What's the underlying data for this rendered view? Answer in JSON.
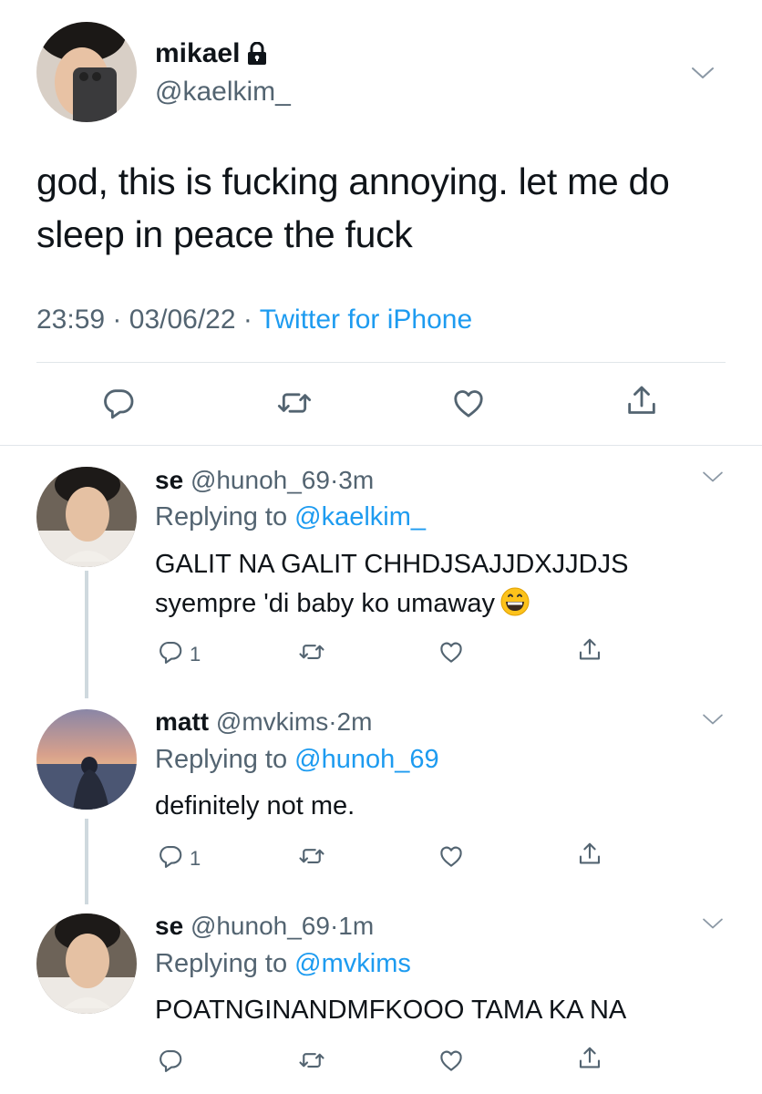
{
  "main_tweet": {
    "name": "mikael",
    "handle": "@kaelkim_",
    "text": "god, this is fucking annoying. let me do sleep in peace the fuck",
    "time": "23:59",
    "date": "03/06/22",
    "source": "Twitter for iPhone",
    "icons": [
      "lock-icon",
      "chevron-down-icon",
      "reply-icon",
      "retweet-icon",
      "like-icon",
      "share-icon"
    ]
  },
  "replies": [
    {
      "name": "se",
      "handle": "@hunoh_69",
      "time": "3m",
      "replying_label": "Replying to",
      "replying_to": "@kaelkim_",
      "line1": "GALIT NA GALIT CHHDJSAJJDXJJDJS",
      "line2": "syempre 'di baby ko umaway",
      "emoji": "grinning-face-emoji",
      "reply_count": "1"
    },
    {
      "name": "matt",
      "handle": "@mvkims",
      "time": "2m",
      "replying_label": "Replying to",
      "replying_to": "@hunoh_69",
      "line1": "definitely not me.",
      "reply_count": "1"
    },
    {
      "name": "se",
      "handle": "@hunoh_69",
      "time": "1m",
      "replying_label": "Replying to",
      "replying_to": "@mvkims",
      "line1": "POATNGINANDMFKOOO TAMA KA NA",
      "reply_count": ""
    }
  ],
  "separator": "·",
  "colors": {
    "accent": "#1d9bf0",
    "muted": "#536471",
    "text": "#0f1419",
    "line": "#cfd9de"
  }
}
